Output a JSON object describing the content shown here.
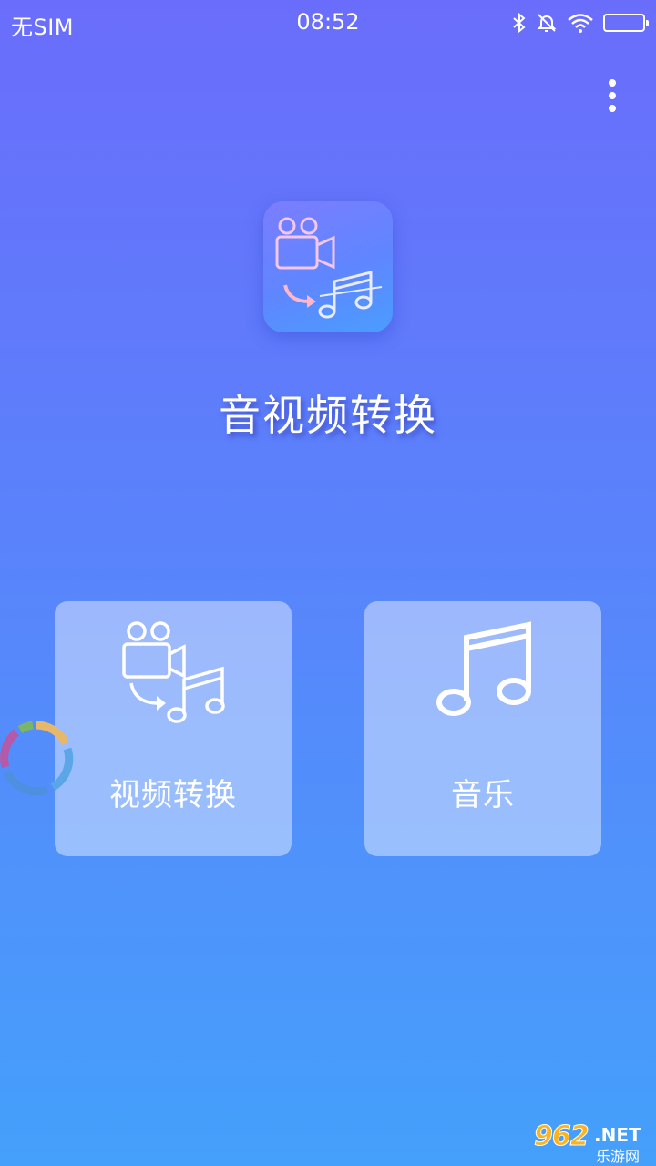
{
  "status_bar": {
    "carrier": "无SIM",
    "time": "08:52"
  },
  "app": {
    "title": "音视频转换"
  },
  "cards": [
    {
      "label": "视频转换",
      "icon": "video-to-music-icon"
    },
    {
      "label": "音乐",
      "icon": "music-note-icon"
    }
  ],
  "watermark": {
    "number": "962",
    "domain": ".NET",
    "sub": "乐游网"
  },
  "colors": {
    "gradient_top": "#6a6dfb",
    "gradient_bottom": "#44a0fb",
    "card_bg": "rgba(255,255,255,0.42)",
    "watermark_accent": "#ffb21e"
  }
}
